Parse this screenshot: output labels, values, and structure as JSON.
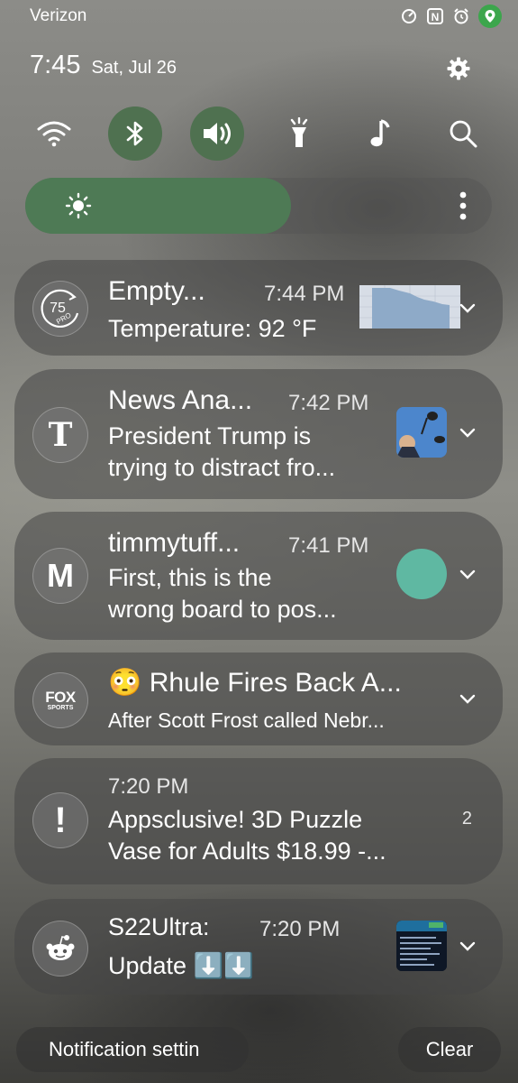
{
  "status_bar": {
    "carrier": "Verizon",
    "icons": [
      "data-saver-icon",
      "nfc-icon",
      "alarm-icon",
      "location-icon"
    ]
  },
  "header": {
    "time": "7:45",
    "date": "Sat, Jul 26",
    "settings_icon": "gear-icon"
  },
  "quick_settings": [
    {
      "name": "wifi",
      "icon": "wifi-icon",
      "active": false
    },
    {
      "name": "bluetooth",
      "icon": "bluetooth-icon",
      "active": true
    },
    {
      "name": "sound",
      "icon": "volume-icon",
      "active": true
    },
    {
      "name": "flashlight",
      "icon": "flashlight-icon",
      "active": false
    },
    {
      "name": "music",
      "icon": "music-note-icon",
      "active": false
    },
    {
      "name": "search",
      "icon": "search-icon",
      "active": false
    }
  ],
  "brightness": {
    "level_percent": 57,
    "icon": "sun-icon"
  },
  "notifications": [
    {
      "app_icon": "forecast-75-pro-icon",
      "app_badge": "75",
      "app_badge_sub": "PRO",
      "title": "Empty...",
      "time": "7:44 PM",
      "body": [
        "Temperature: 92 °F"
      ]
    },
    {
      "app_icon": "nyt-icon",
      "app_badge": "T",
      "title": "News Ana...",
      "time": "7:42 PM",
      "body": [
        "President Trump is",
        "trying to distract fro..."
      ]
    },
    {
      "app_icon": "m-icon",
      "app_badge": "M",
      "title": "timmytuff...",
      "time": "7:41 PM",
      "body": [
        "First, this is the",
        "wrong board to pos..."
      ]
    },
    {
      "app_icon": "fox-sports-icon",
      "app_badge": "FOX",
      "app_badge_sub": "SPORTS",
      "title": "😳 Rhule Fires Back A...",
      "time": "",
      "body": [
        "After Scott Frost called Nebr..."
      ]
    },
    {
      "app_icon": "alert-icon",
      "app_badge": "!",
      "title": "",
      "time": "7:20 PM",
      "body": [
        "Appsclusive! 3D Puzzle",
        "Vase for Adults $18.99 -..."
      ],
      "count": "2"
    },
    {
      "app_icon": "reddit-icon",
      "title": "S22Ultra:",
      "time": "7:20 PM",
      "body": [
        "Update ⬇️⬇️"
      ]
    }
  ],
  "footer": {
    "settings_label": "Notification settin",
    "clear_label": "Clear"
  },
  "colors": {
    "toggle_on": "#4f7150",
    "brightness_fill": "#4e7a55",
    "location_green": "#3ca64c"
  }
}
